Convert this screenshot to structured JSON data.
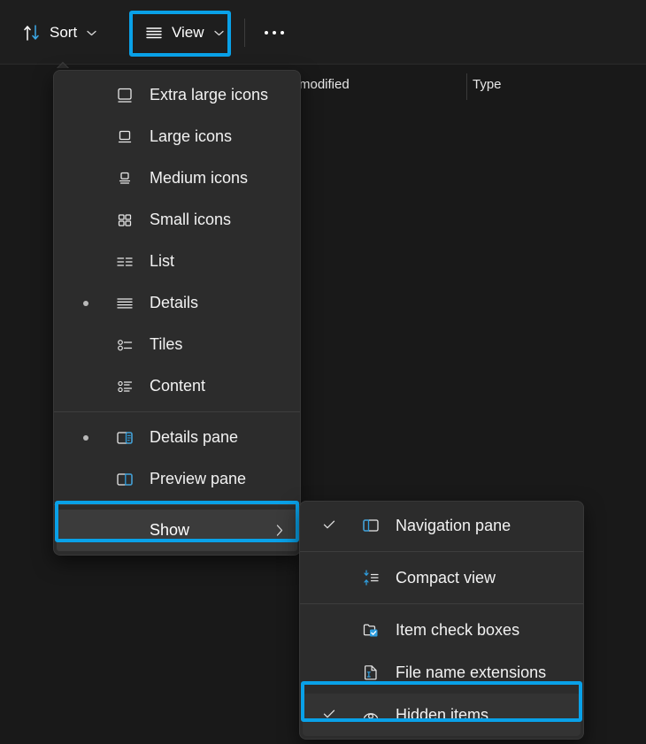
{
  "theme": {
    "background": "#191919",
    "menu_bg": "#2c2c2c",
    "accent": "#09a1e8",
    "text": "#f2f2f2",
    "separator": "#3d3d3d",
    "highlight_row_bg": "#3b3b3b"
  },
  "toolbar": {
    "sort": {
      "label": "Sort",
      "icon": "sort-arrows-icon",
      "chevron": "⌄"
    },
    "view": {
      "label": "View",
      "icon": "view-lines-icon",
      "chevron": "⌄",
      "highlighted": true
    },
    "more": {
      "label": "...",
      "icon": "ellipsis-icon"
    }
  },
  "column_headers": [
    {
      "label": "modified",
      "name": "column-header-date-modified"
    },
    {
      "label": "Type",
      "name": "column-header-type"
    }
  ],
  "view_menu": {
    "groups": [
      {
        "items": [
          {
            "label": "Extra large icons",
            "icon": "extra-large-icons-icon",
            "selected": false
          },
          {
            "label": "Large icons",
            "icon": "large-icons-icon",
            "selected": false
          },
          {
            "label": "Medium icons",
            "icon": "medium-icons-icon",
            "selected": false
          },
          {
            "label": "Small icons",
            "icon": "small-icons-icon",
            "selected": false
          },
          {
            "label": "List",
            "icon": "list-icon",
            "selected": false
          },
          {
            "label": "Details",
            "icon": "details-icon",
            "selected": true
          },
          {
            "label": "Tiles",
            "icon": "tiles-icon",
            "selected": false
          },
          {
            "label": "Content",
            "icon": "content-icon",
            "selected": false
          }
        ]
      },
      {
        "items": [
          {
            "label": "Details pane",
            "icon": "details-pane-icon",
            "selected": true
          },
          {
            "label": "Preview pane",
            "icon": "preview-pane-icon",
            "selected": false
          }
        ]
      }
    ],
    "show": {
      "label": "Show",
      "chevron": "›",
      "highlighted": true,
      "expanded": true
    }
  },
  "show_submenu": {
    "items": [
      {
        "label": "Navigation pane",
        "icon": "navigation-pane-icon",
        "checked": true,
        "highlighted": false
      },
      {
        "label": "Compact view",
        "icon": "compact-view-icon",
        "checked": false,
        "highlighted": false
      },
      {
        "label": "Item check boxes",
        "icon": "item-check-boxes-icon",
        "checked": false,
        "highlighted": false
      },
      {
        "label": "File name extensions",
        "icon": "file-name-extensions-icon",
        "checked": false,
        "highlighted": false
      },
      {
        "label": "Hidden items",
        "icon": "hidden-items-icon",
        "checked": true,
        "highlighted": true
      }
    ]
  }
}
